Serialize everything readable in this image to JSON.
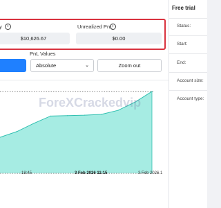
{
  "metrics": {
    "balance": {
      "label_suffix": "y",
      "value": "$10,626.67"
    },
    "unrealized_pnl": {
      "label": "Unrealized PnL",
      "value": "$0.00"
    }
  },
  "controls": {
    "pnl_values_label": "PnL Values",
    "pnl_values_selected": "Absolute",
    "zoom_out_label": "Zoom out"
  },
  "chart": {
    "x_ticks": [
      "18:45",
      "3 Feb 2026 11:15",
      "3 Feb 2026 1"
    ],
    "fill_color": "#a6ece3",
    "line_color": "#2fbfb0",
    "watermark": "ForeXCrackedvip"
  },
  "chart_data": {
    "type": "area",
    "title": "",
    "xlabel": "",
    "ylabel": "",
    "x": [
      0,
      1,
      2,
      3,
      4,
      5,
      6,
      7,
      8,
      9
    ],
    "series": [
      {
        "values": [
          44,
          51,
          61,
          70,
          70.5,
          71,
          72,
          77,
          87,
          100
        ]
      }
    ],
    "ylim": [
      0,
      105
    ],
    "grid": false,
    "reference_lines": [
      "top dotted",
      "bottom dotted"
    ]
  },
  "sidebar": {
    "title": "Free trial",
    "fields": [
      {
        "label": "Status:"
      },
      {
        "label": "Start:"
      },
      {
        "label": "End:"
      },
      {
        "label": "Account size:"
      },
      {
        "label": "Account type:"
      }
    ]
  },
  "colors": {
    "highlight_border": "#d9333f",
    "primary_button": "#1f80ff"
  }
}
